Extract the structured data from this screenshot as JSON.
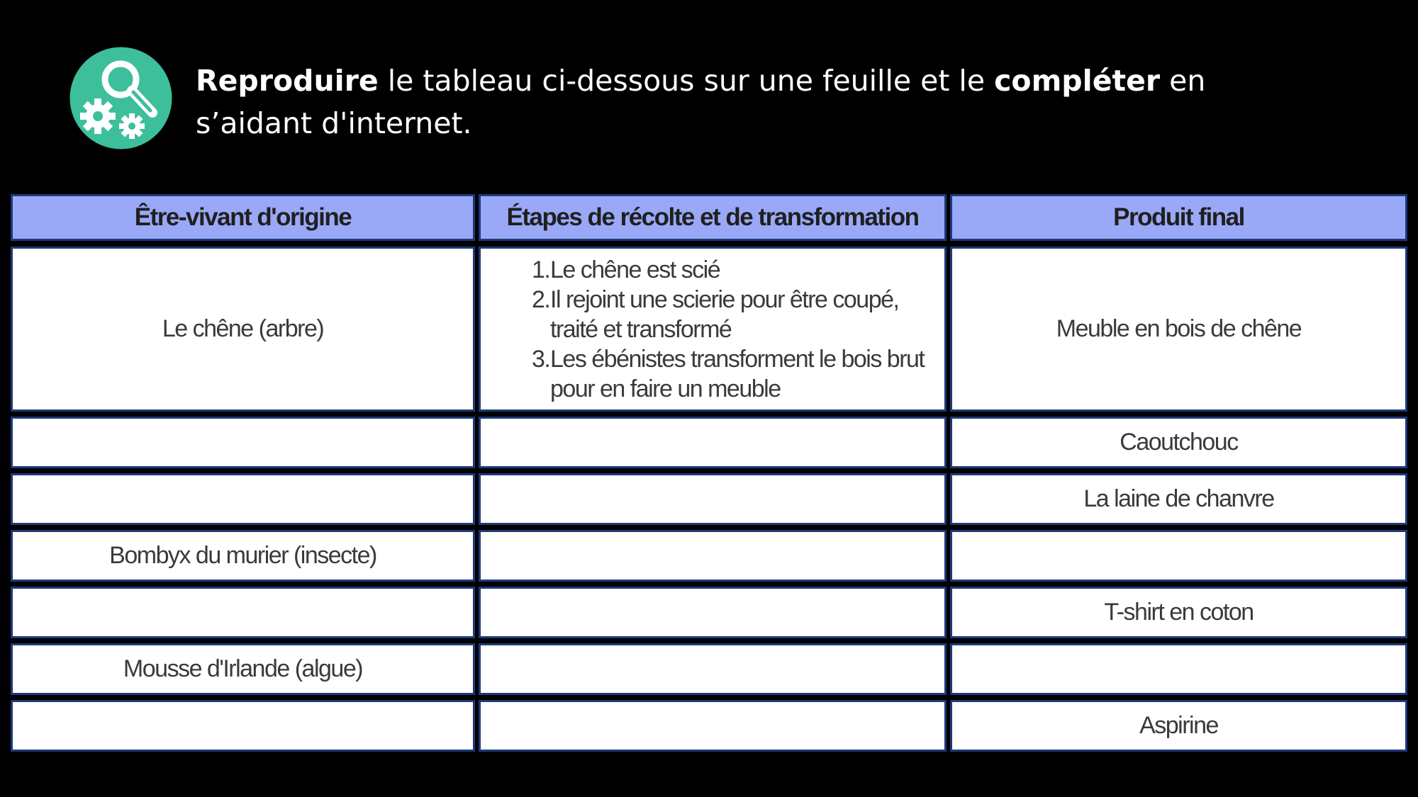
{
  "instruction": {
    "bold1": "Reproduire",
    "text1": " le tableau ci-dessous sur une feuille et le ",
    "bold2": "compléter",
    "text2": " en s’aidant d'internet."
  },
  "icon": {
    "name": "search-gears-icon",
    "color": "#3dbf9c"
  },
  "table": {
    "headers": [
      "Être-vivant d'origine",
      "Étapes de récolte et de transformation",
      "Produit final"
    ],
    "header_color": "#99a9f7",
    "rows": [
      {
        "origin": "Le chêne (arbre)",
        "steps": [
          {
            "num": "1.",
            "text": "Le chêne est scié"
          },
          {
            "num": "2.",
            "text": "Il rejoint une scierie pour être coupé, traité et transformé"
          },
          {
            "num": "3.",
            "text": "Les ébénistes transforment le bois brut pour en faire un meuble"
          }
        ],
        "product": "Meuble en bois de chêne"
      },
      {
        "origin": "",
        "product": "Caoutchouc"
      },
      {
        "origin": "",
        "product": "La laine de chanvre"
      },
      {
        "origin": "Bombyx du murier (insecte)",
        "product": ""
      },
      {
        "origin": "",
        "product": "T-shirt en coton"
      },
      {
        "origin": "Mousse d'Irlande (algue)",
        "product": ""
      },
      {
        "origin": "",
        "product": "Aspirine"
      }
    ]
  }
}
